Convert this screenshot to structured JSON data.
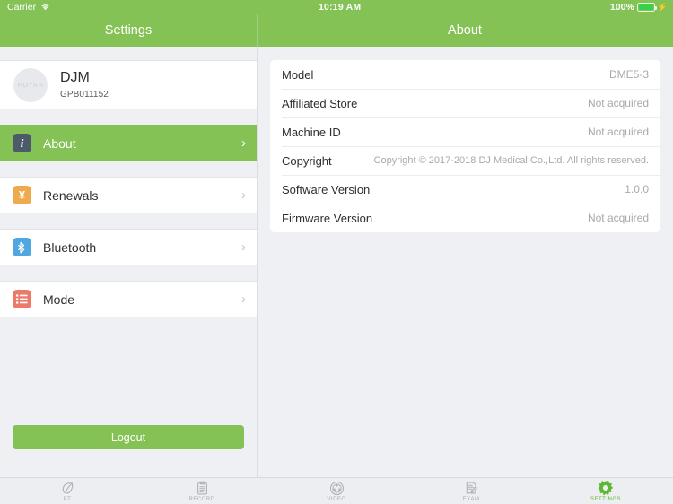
{
  "statusbar": {
    "carrier": "Carrier",
    "wifi_icon": "wifi-icon",
    "time": "10:19 AM",
    "battery_percent": "100%",
    "battery_icon": "battery-charging-icon"
  },
  "nav": {
    "left_title": "Settings",
    "right_title": "About"
  },
  "profile": {
    "avatar_text": "HOYAR",
    "name": "DJM",
    "id": "GPB011152"
  },
  "sidebar": {
    "items": [
      {
        "label": "About",
        "icon": "info-icon",
        "glyph": "i",
        "selected": true
      },
      {
        "label": "Renewals",
        "icon": "currency-yen-icon",
        "glyph": "¥",
        "selected": false
      },
      {
        "label": "Bluetooth",
        "icon": "bluetooth-icon",
        "glyph": "",
        "selected": false
      },
      {
        "label": "Mode",
        "icon": "list-icon",
        "glyph": "",
        "selected": false
      }
    ],
    "logout_label": "Logout"
  },
  "about": {
    "rows": [
      {
        "key": "Model",
        "value": "DME5-3"
      },
      {
        "key": "Affiliated Store",
        "value": "Not acquired"
      },
      {
        "key": "Machine ID",
        "value": "Not acquired"
      },
      {
        "key": "Copyright",
        "value": "Copyright © 2017-2018 DJ Medical Co.,Ltd. All rights reserved."
      },
      {
        "key": "Software Version",
        "value": "1.0.0"
      },
      {
        "key": "Firmware Version",
        "value": "Not acquired"
      }
    ]
  },
  "tabbar": {
    "tabs": [
      {
        "label": "PT",
        "icon": "leaf-icon",
        "active": false
      },
      {
        "label": "RECORD",
        "icon": "clipboard-icon",
        "active": false
      },
      {
        "label": "VIDEO",
        "icon": "film-reel-icon",
        "active": false
      },
      {
        "label": "EXAM",
        "icon": "document-edit-icon",
        "active": false
      },
      {
        "label": "SETTINGS",
        "icon": "gear-icon",
        "active": true
      }
    ]
  },
  "colors": {
    "brand_green": "#85c255",
    "active_green": "#5cb82e",
    "background": "#eff0f4",
    "info_icon": "#4c5a69",
    "renewals_icon": "#eeaa4d",
    "bluetooth_icon": "#50a7e0",
    "mode_icon": "#ec7a69"
  }
}
